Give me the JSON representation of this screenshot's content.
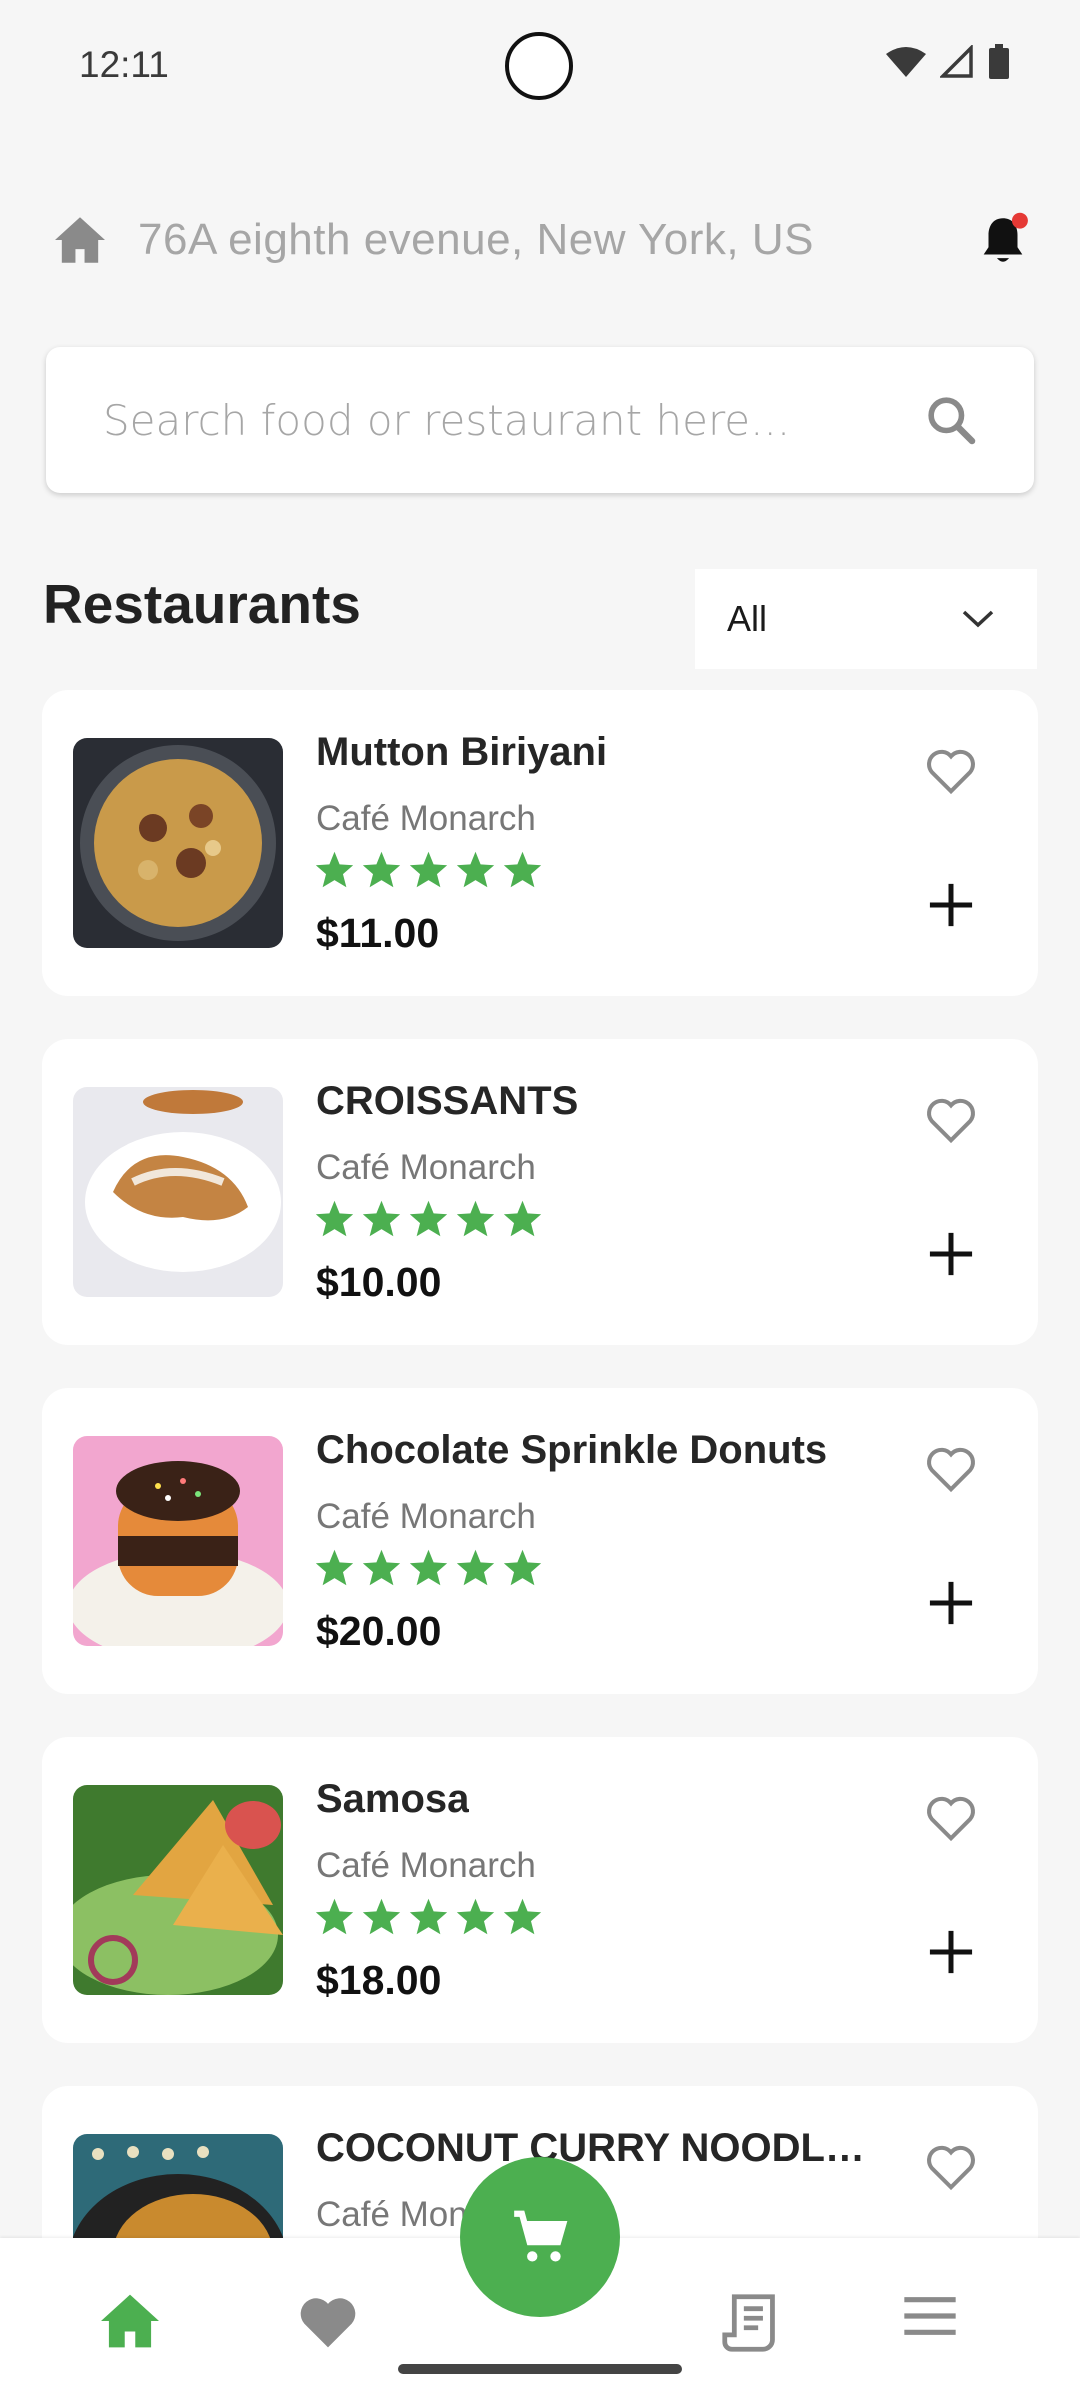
{
  "status_bar": {
    "time": "12:11"
  },
  "header": {
    "address": "76A eighth evenue, New York, US"
  },
  "search": {
    "placeholder": "Search food or restaurant here..."
  },
  "section": {
    "title": "Restaurants",
    "filter_value": "All"
  },
  "items": [
    {
      "name": "Mutton Biriyani",
      "cafe": "Café Monarch",
      "rating": 5,
      "price": "$11.00"
    },
    {
      "name": "CROISSANTS",
      "cafe": "Café Monarch",
      "rating": 5,
      "price": "$10.00"
    },
    {
      "name": "Chocolate Sprinkle Donuts",
      "cafe": "Café Monarch",
      "rating": 5,
      "price": "$20.00"
    },
    {
      "name": "Samosa",
      "cafe": "Café Monarch",
      "rating": 5,
      "price": "$18.00"
    },
    {
      "name": "COCONUT CURRY NOODLE …",
      "cafe": "Café Monarch"
    }
  ],
  "colors": {
    "accent": "#4caf50",
    "star": "#4caf50",
    "notification_dot": "#e53935"
  },
  "icons": [
    "home-icon",
    "bell-icon",
    "search-icon",
    "chevron-down-icon",
    "heart-outline-icon",
    "plus-icon",
    "cart-icon",
    "heart-icon",
    "receipt-icon",
    "menu-icon"
  ]
}
